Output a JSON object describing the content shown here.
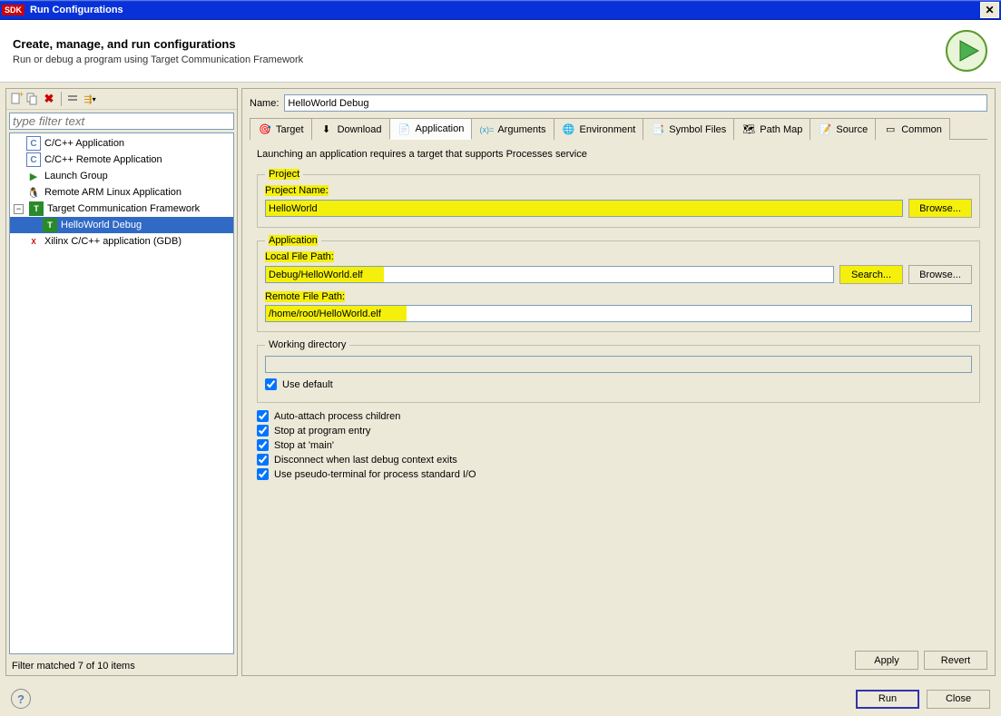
{
  "window": {
    "title": "Run Configurations",
    "sdk_badge": "SDK"
  },
  "header": {
    "title": "Create, manage, and run configurations",
    "subtitle": "Run or debug a program using Target Communication Framework"
  },
  "filter_placeholder": "type filter text",
  "tree": {
    "items": [
      {
        "label": "C/C++ Application",
        "icon": "c"
      },
      {
        "label": "C/C++ Remote Application",
        "icon": "c"
      },
      {
        "label": "Launch Group",
        "icon": "green-arrow"
      },
      {
        "label": "Remote ARM Linux Application",
        "icon": "penguin"
      },
      {
        "label": "Target Communication Framework",
        "icon": "tcf",
        "expanded": true,
        "children": [
          {
            "label": "HelloWorld Debug",
            "icon": "tcf",
            "selected": true
          }
        ]
      },
      {
        "label": "Xilinx C/C++ application (GDB)",
        "icon": "gdb"
      }
    ]
  },
  "filter_status": "Filter matched 7 of 10 items",
  "name_label": "Name:",
  "name_value": "HelloWorld Debug",
  "tabs": [
    {
      "label": "Target",
      "icon": "target"
    },
    {
      "label": "Download",
      "icon": "download"
    },
    {
      "label": "Application",
      "icon": "application",
      "active": true
    },
    {
      "label": "Arguments",
      "icon": "arguments"
    },
    {
      "label": "Environment",
      "icon": "environment"
    },
    {
      "label": "Symbol Files",
      "icon": "symbol"
    },
    {
      "label": "Path Map",
      "icon": "pathmap"
    },
    {
      "label": "Source",
      "icon": "source"
    },
    {
      "label": "Common",
      "icon": "common"
    }
  ],
  "app_tab": {
    "info": "Launching an application requires a target that supports Processes service",
    "project_legend": "Project",
    "project_name_label": "Project Name:",
    "project_name_value": "HelloWorld",
    "browse": "Browse...",
    "application_legend": "Application",
    "local_path_label": "Local File Path:",
    "local_path_value": "Debug/HelloWorld.elf",
    "search": "Search...",
    "remote_path_label": "Remote File Path:",
    "remote_path_value": "/home/root/HelloWorld.elf",
    "workdir_legend": "Working directory",
    "workdir_value": "",
    "use_default": "Use default",
    "checks": {
      "auto_attach": "Auto-attach process children",
      "stop_entry": "Stop at program entry",
      "stop_main": "Stop at 'main'",
      "disconnect": "Disconnect when last debug context exits",
      "pseudo": "Use pseudo-terminal for process standard I/O"
    }
  },
  "buttons": {
    "apply": "Apply",
    "revert": "Revert",
    "run": "Run",
    "close": "Close"
  }
}
